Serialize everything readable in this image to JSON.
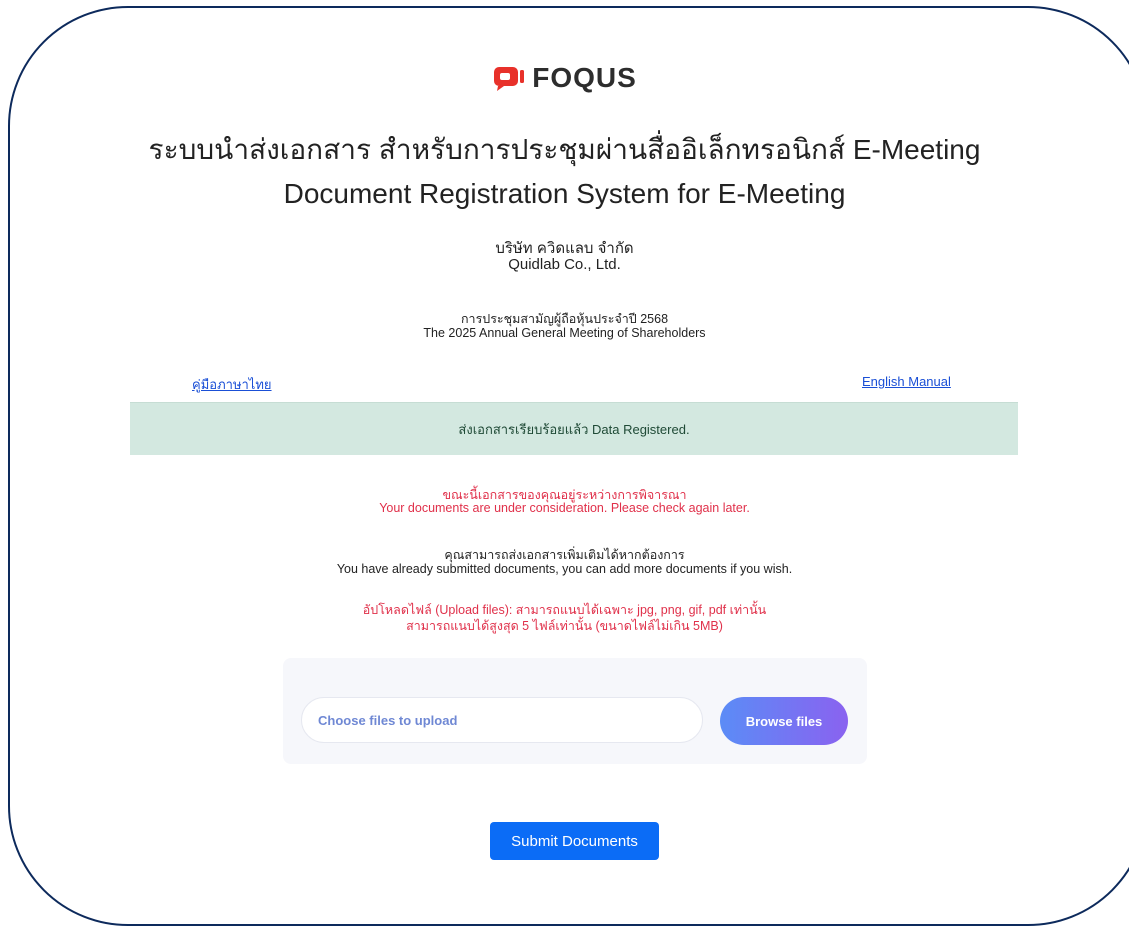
{
  "brand": {
    "name": "FOQUS",
    "color": "#e8312a"
  },
  "header": {
    "title_th": "ระบบนำส่งเอกสาร สำหรับการประชุมผ่านสื่ออิเล็กทรอนิกส์ E-Meeting",
    "title_en": "Document Registration System for E-Meeting"
  },
  "company": {
    "name_th": "บริษัท ควิดแลบ จำกัด",
    "name_en": "Quidlab Co., Ltd."
  },
  "meeting": {
    "name_th": "การประชุมสามัญผู้ถือหุ้นประจำปี 2568",
    "name_en": "The 2025 Annual General Meeting of Shareholders"
  },
  "links": {
    "manual_th": "คู่มือภาษาไทย",
    "manual_en": "English Manual"
  },
  "status": {
    "text": "ส่งเอกสารเรียบร้อยแล้ว Data Registered."
  },
  "notices": {
    "review_th": "ขณะนี้เอกสารของคุณอยู่ระหว่างการพิจารณา",
    "review_en": "Your documents are under consideration. Please check again later.",
    "add_th": "คุณสามารถส่งเอกสารเพิ่มเติมได้หากต้องการ",
    "add_en": "You have already submitted documents, you can add more documents if you wish.",
    "upload_rule_1": "อัปโหลดไฟล์ (Upload files): สามารถแนบได้เฉพาะ jpg, png, gif, pdf เท่านั้น",
    "upload_rule_2": "สามารถแนบได้สูงสุด 5 ไฟล์เท่านั้น (ขนาดไฟล์ไม่เกิน 5MB)"
  },
  "upload": {
    "placeholder": "Choose files to upload",
    "browse_label": "Browse files"
  },
  "actions": {
    "submit_label": "Submit Documents"
  }
}
